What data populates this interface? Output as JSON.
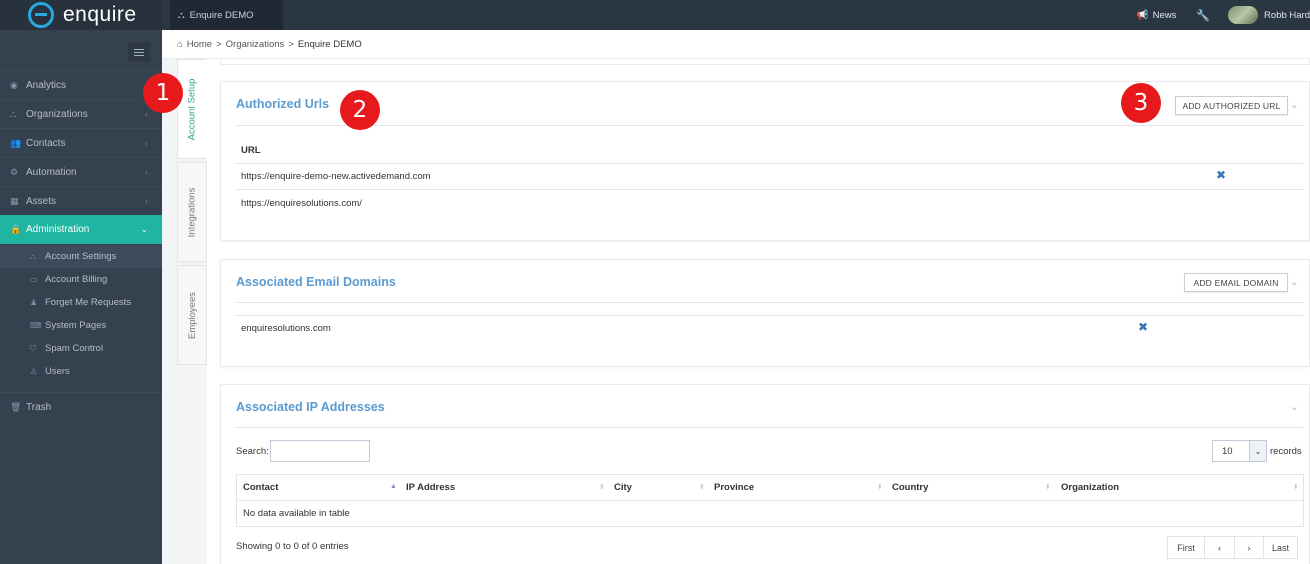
{
  "app": {
    "name": "enquire"
  },
  "topbar": {
    "tab": "Enquire DEMO",
    "news": "News",
    "user": "Robb Hard"
  },
  "breadcrumb": {
    "home": "Home",
    "sep1": ">",
    "organizations": "Organizations",
    "sep2": ">",
    "current": "Enquire DEMO"
  },
  "sidebar": {
    "items": [
      {
        "label": "Analytics",
        "icon": "dashboard-icon"
      },
      {
        "label": "Organizations",
        "icon": "sitemap-icon"
      },
      {
        "label": "Contacts",
        "icon": "users-icon"
      },
      {
        "label": "Automation",
        "icon": "cogs-icon"
      },
      {
        "label": "Assets",
        "icon": "grid-icon"
      },
      {
        "label": "Administration",
        "icon": "lock-icon"
      }
    ],
    "sub_items": [
      {
        "label": "Account Settings",
        "icon": "sitemap-icon"
      },
      {
        "label": "Account Billing",
        "icon": "file-icon"
      },
      {
        "label": "Forget Me Requests",
        "icon": "user-x-icon"
      },
      {
        "label": "System Pages",
        "icon": "keyboard-icon"
      },
      {
        "label": "Spam Control",
        "icon": "shield-icon"
      },
      {
        "label": "Users",
        "icon": "user-icon"
      }
    ],
    "trash": "Trash"
  },
  "vertical_tabs": [
    "Account Setup",
    "Integrations",
    "Employees"
  ],
  "annotations": [
    "1",
    "2",
    "3"
  ],
  "authorized_urls": {
    "title": "Authorized Urls",
    "add_button": "ADD AUTHORIZED URL",
    "column": "URL",
    "rows": [
      "https://enquire-demo-new.activedemand.com",
      "https://enquiresolutions.com/"
    ]
  },
  "email_domains": {
    "title": "Associated Email Domains",
    "add_button": "ADD EMAIL DOMAIN",
    "rows": [
      "enquiresolutions.com"
    ]
  },
  "ip_addresses": {
    "title": "Associated IP Addresses",
    "search_label": "Search:",
    "records_value": "10",
    "records_label": "records",
    "columns": [
      "Contact",
      "IP Address",
      "City",
      "Province",
      "Country",
      "Organization"
    ],
    "empty_text": "No data available in table",
    "info": "Showing 0 to 0 of 0 entries",
    "pager": {
      "first": "First",
      "prev": "‹",
      "next": "›",
      "last": "Last"
    }
  },
  "colors": {
    "accent": "#1fb5a1",
    "link": "#5b9bd1",
    "sidebar": "#364150",
    "badge": "#e8191d"
  }
}
